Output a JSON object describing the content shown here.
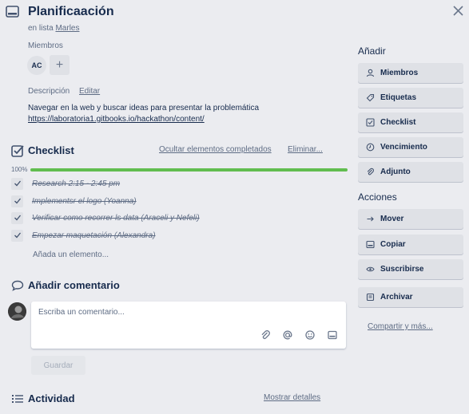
{
  "card": {
    "title": "Planificaación",
    "in_list_prefix": "en lista",
    "list_name": "Marles"
  },
  "members": {
    "label": "Miembros",
    "avatar_initials": "AC",
    "add_symbol": "+"
  },
  "description": {
    "label": "Descripción",
    "edit_link": "Editar",
    "text": "Navegar en la web y buscar ideas para presentar la problemática",
    "url": "https://laboratoria1.gitbooks.io/hackathon/content/"
  },
  "checklist": {
    "title": "Checklist",
    "hide_completed": "Ocultar elementos completados",
    "delete": "Eliminar...",
    "progress_label": "100%",
    "progress": 1.0,
    "items": [
      {
        "text": "Research 2:15 - 2:45 pm",
        "done": true
      },
      {
        "text": "Implementsr el logo (Yoanna)",
        "done": true
      },
      {
        "text": "Verificar como recorrer ls data (Araceli y Nefeli)",
        "done": true
      },
      {
        "text": "Empezar maquetación (Alexandra)",
        "done": true
      }
    ],
    "add_item": "Añada un elemento..."
  },
  "comment": {
    "title": "Añadir comentario",
    "placeholder": "Escriba un comentario...",
    "save": "Guardar"
  },
  "activity": {
    "title": "Actividad",
    "show_details": "Mostrar detalles"
  },
  "sidebar": {
    "add_title": "Añadir",
    "add_buttons": [
      {
        "label": "Miembros",
        "icon": "person-icon"
      },
      {
        "label": "Etiquetas",
        "icon": "tag-icon"
      },
      {
        "label": "Checklist",
        "icon": "checkbox-icon"
      },
      {
        "label": "Vencimiento",
        "icon": "clock-icon"
      },
      {
        "label": "Adjunto",
        "icon": "paperclip-icon"
      }
    ],
    "actions_title": "Acciones",
    "action_buttons": [
      {
        "label": "Mover",
        "icon": "arrow-right-icon"
      },
      {
        "label": "Copiar",
        "icon": "card-icon"
      },
      {
        "label": "Suscribirse",
        "icon": "eye-icon"
      },
      {
        "label": "Archivar",
        "icon": "archive-icon"
      }
    ],
    "share": "Compartir y más..."
  },
  "colors": {
    "background": "#ebecf0",
    "progress": "#61bd4f",
    "text": "#172b4d",
    "muted": "#5e6c84"
  }
}
